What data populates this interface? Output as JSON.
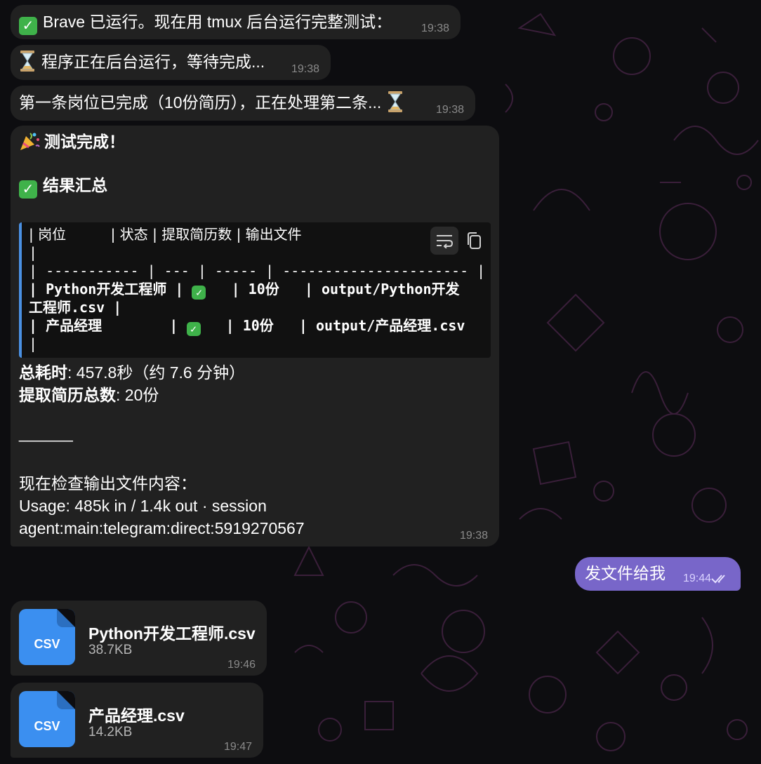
{
  "messages": [
    {
      "text": "Brave 已运行。现在用 tmux 后台运行完整测试：",
      "time": "19:38",
      "icon": "check-emoji"
    },
    {
      "text": "程序正在后台运行，等待完成...",
      "time": "19:38",
      "icon": "hourglass-emoji"
    },
    {
      "text": "第一条岗位已完成（10份简历），正在处理第二条...",
      "time": "19:38",
      "icon": "hourglass-emoji"
    }
  ],
  "summary": {
    "heading": "测试完成！",
    "result_title": "结果汇总",
    "code_lines": [
      "| 岗位          | 状态 | 提取简历数 | 输出文件",
      "|",
      "| ----------- | --- | ----- | ---------------------- |",
      "| Python开发工程师 | ",
      "   | 10份   | output/Python开发",
      "工程师.csv |",
      "| 产品经理        | ",
      "   | 10份   | output/产品经理.csv",
      "|"
    ],
    "total_time_label": "总耗时",
    "total_time_value": ": 457.8秒（约 7.6 分钟）",
    "total_resumes_label": "提取简历总数",
    "total_resumes_value": ": 20份",
    "divider": "______",
    "check_output": "现在检查输出文件内容：",
    "usage": "Usage: 485k in / 1.4k out · session",
    "session": "agent:main:telegram:direct:5919270567",
    "time": "19:38"
  },
  "outgoing": {
    "text": "发文件给我",
    "time": "19:44"
  },
  "files": [
    {
      "ext": "CSV",
      "name": "Python开发工程师.csv",
      "size": "38.7KB",
      "time": "19:46"
    },
    {
      "ext": "CSV",
      "name": "产品经理.csv",
      "size": "14.2KB",
      "time": "19:47"
    }
  ],
  "colors": {
    "bubble": "#212121",
    "outgoing": "#7866c9",
    "file_icon": "#3b8ff0",
    "code_bar": "#4a90e2",
    "check": "#3fb24a"
  }
}
